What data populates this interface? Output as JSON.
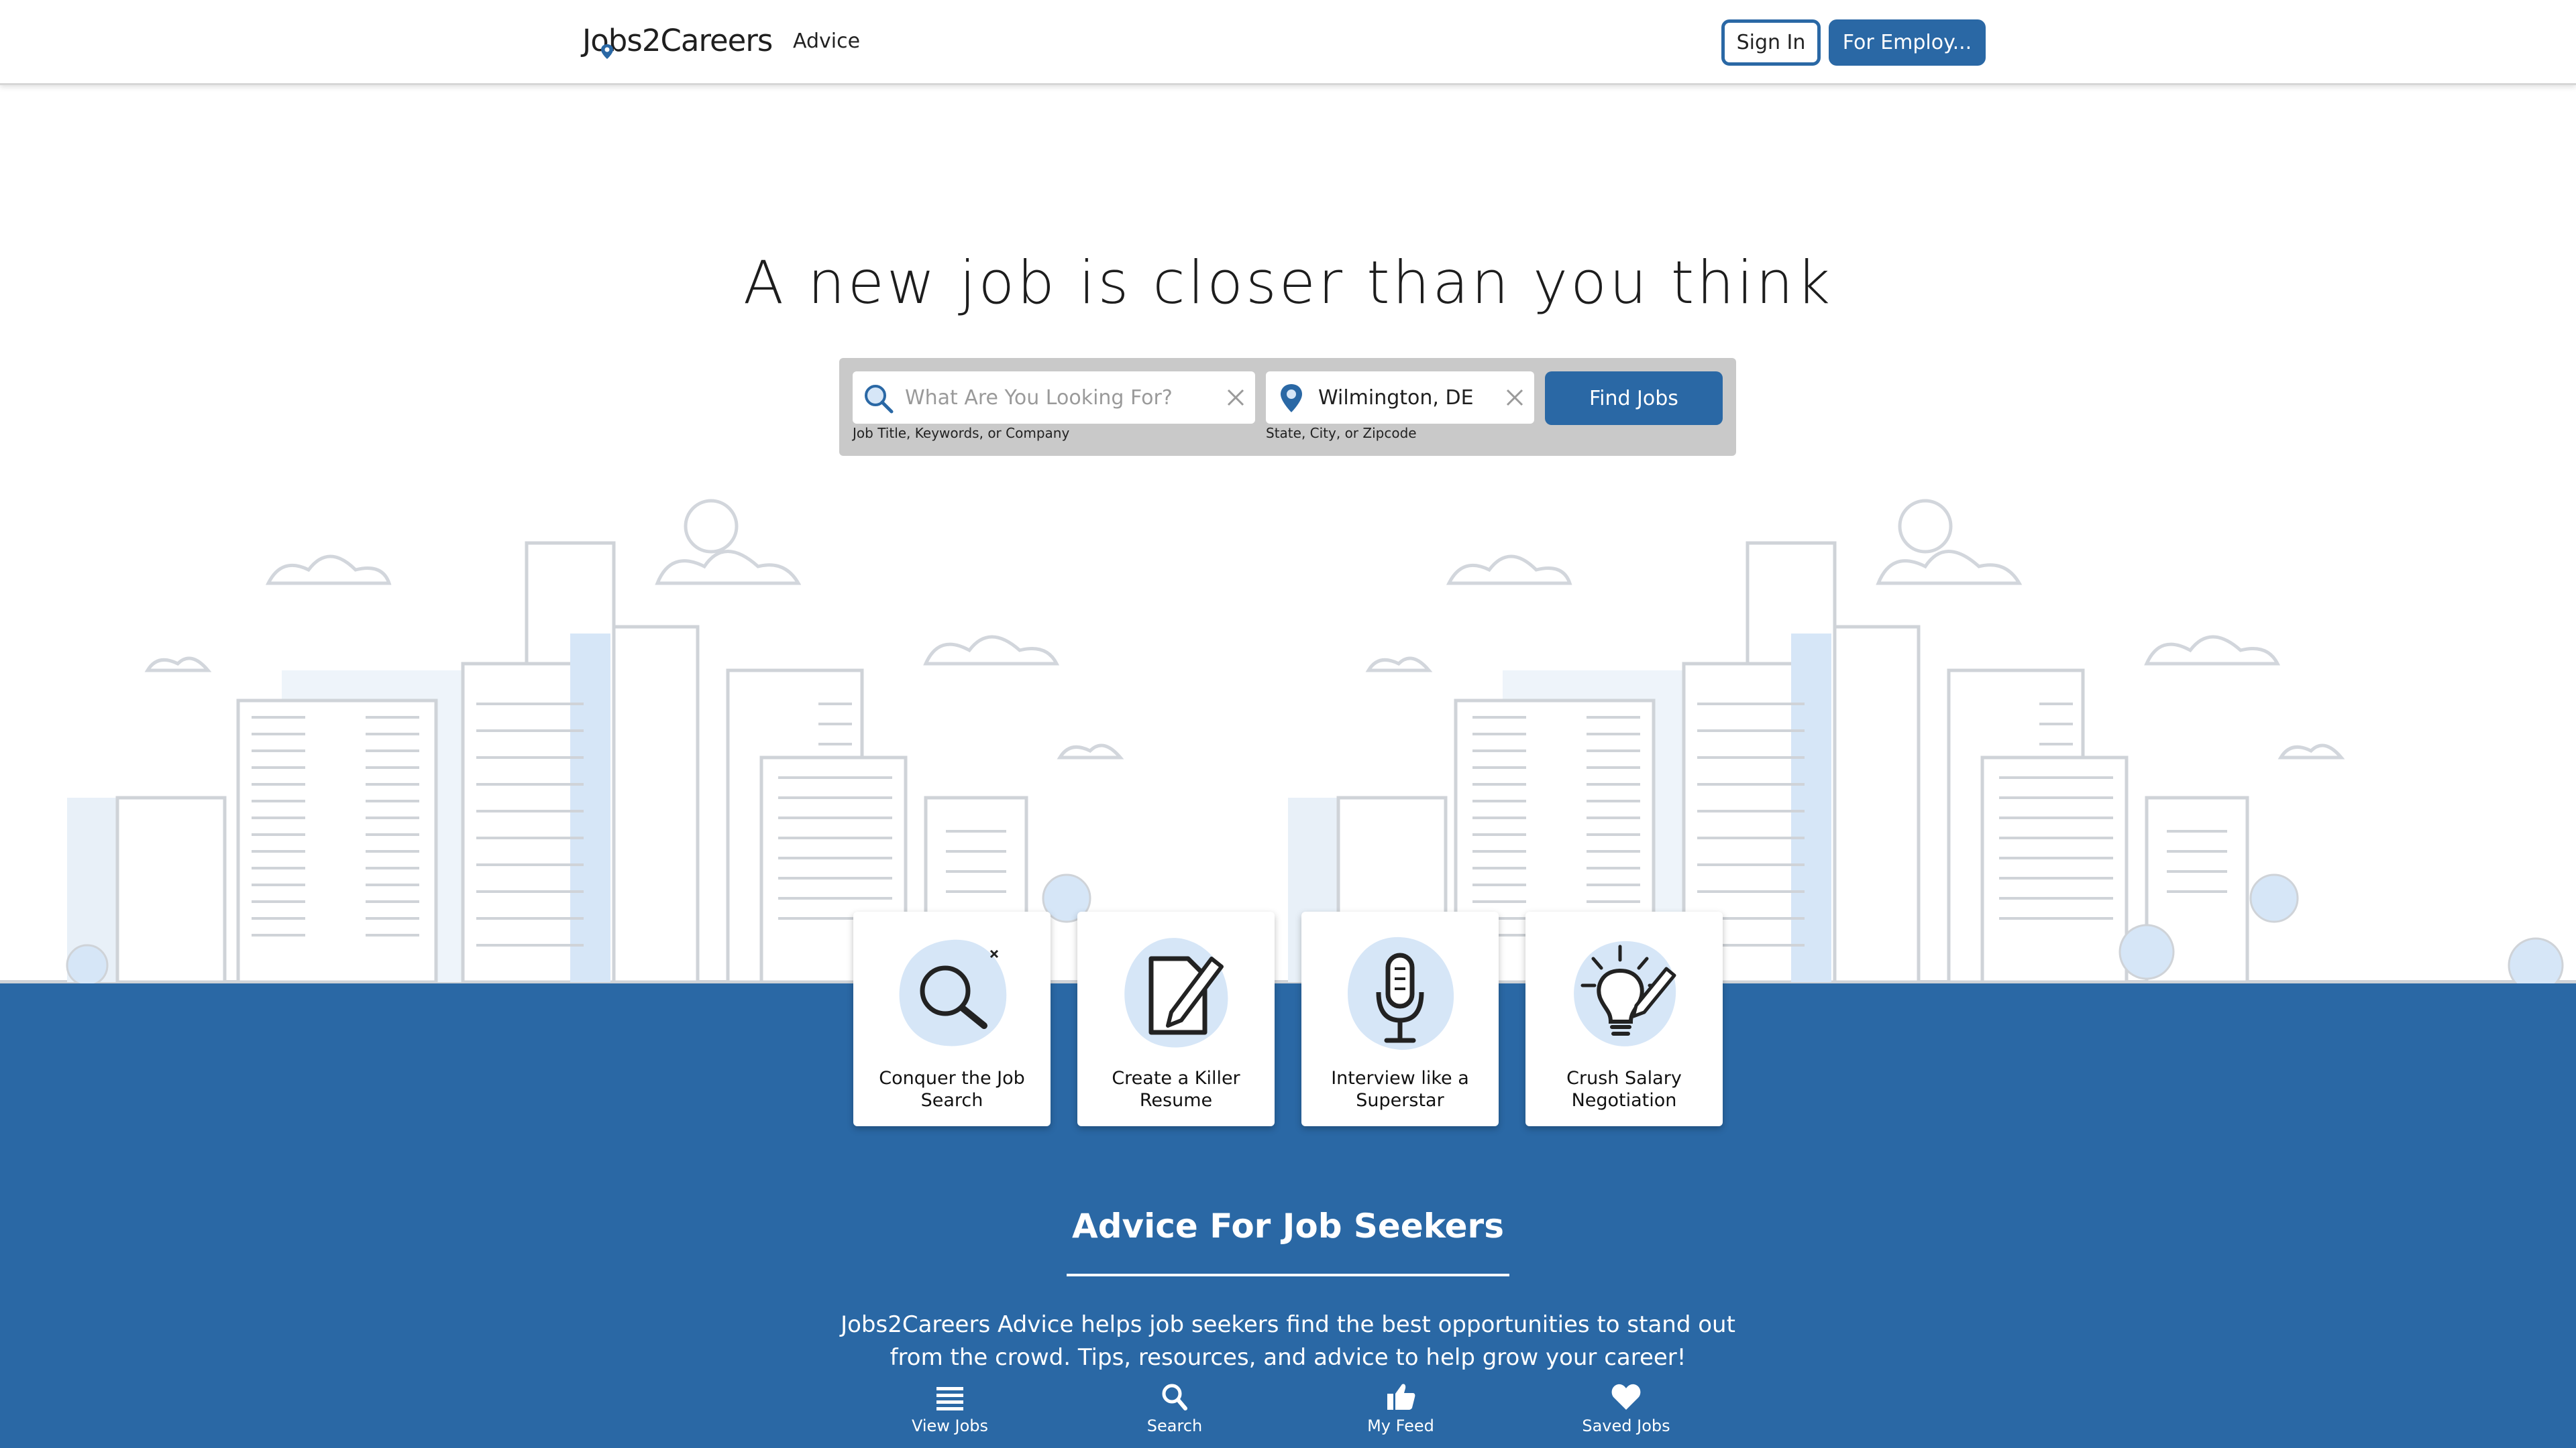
{
  "header": {
    "logo_text": "Jobs2Careers",
    "nav_advice": "Advice",
    "sign_in_label": "Sign In",
    "employers_label": "For Employ..."
  },
  "hero": {
    "title": "A new job is closer than you think"
  },
  "search": {
    "what_placeholder": "What Are You Looking For?",
    "what_value": "",
    "what_hint": "Job Title, Keywords, or Company",
    "where_value": "Wilmington, DE",
    "where_hint": "State, City, or Zipcode",
    "find_label": "Find Jobs"
  },
  "cards": [
    {
      "label": "Conquer the Job Search",
      "icon": "magnifier-icon"
    },
    {
      "label": "Create a Killer Resume",
      "icon": "pen-paper-icon"
    },
    {
      "label": "Interview like a Superstar",
      "icon": "microphone-icon"
    },
    {
      "label": "Crush Salary Negotiation",
      "icon": "lightbulb-icon"
    }
  ],
  "advice": {
    "title": "Advice For Job Seekers",
    "text": "Jobs2Careers Advice helps job seekers find the best opportunities to stand out from the crowd. Tips, resources, and advice to help grow your career!"
  },
  "bottom_nav": [
    {
      "label": "View Jobs",
      "icon": "list-icon"
    },
    {
      "label": "Search",
      "icon": "search-icon"
    },
    {
      "label": "My Feed",
      "icon": "thumbs-up-icon"
    },
    {
      "label": "Saved Jobs",
      "icon": "heart-icon"
    }
  ],
  "colors": {
    "brand_blue": "#2a68a5",
    "accent_light_blue": "#d6e6f7"
  }
}
